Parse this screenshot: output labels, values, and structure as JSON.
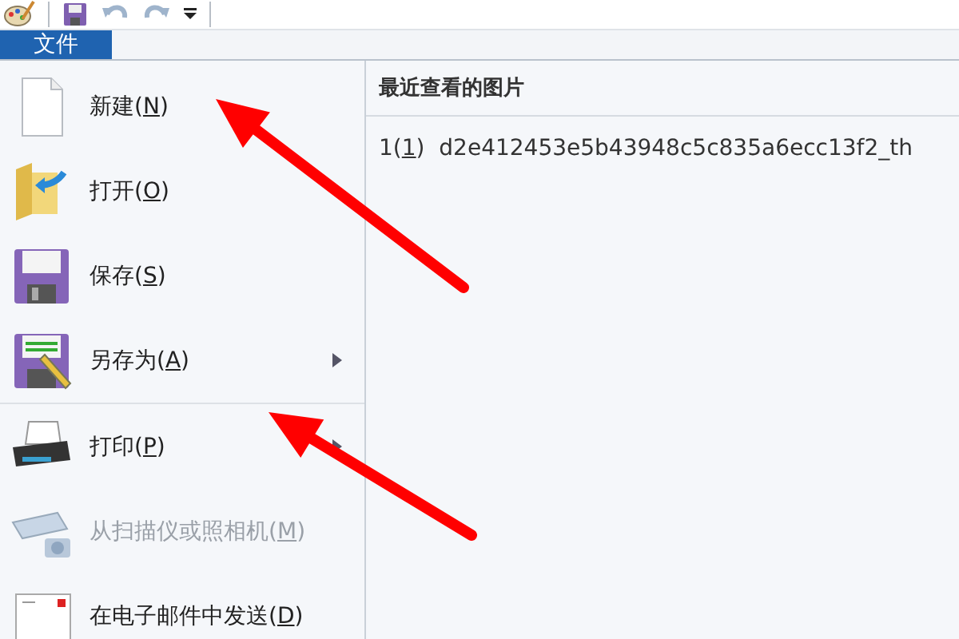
{
  "toolbar": {
    "items": [
      {
        "kind": "paint"
      },
      {
        "kind": "save"
      },
      {
        "kind": "undo",
        "disabled": true
      },
      {
        "kind": "redo",
        "disabled": true
      },
      {
        "kind": "customize"
      }
    ]
  },
  "tabs": [
    {
      "label": "文件",
      "selected": true
    }
  ],
  "menu": {
    "items": [
      {
        "kind": "new",
        "prefix": "新建(",
        "key": "N",
        "suffix": ")",
        "disabled": false,
        "has_submenu": false
      },
      {
        "kind": "open",
        "prefix": "打开(",
        "key": "O",
        "suffix": ")",
        "disabled": false,
        "has_submenu": false
      },
      {
        "kind": "save",
        "prefix": "保存(",
        "key": "S",
        "suffix": ")",
        "disabled": false,
        "has_submenu": false
      },
      {
        "kind": "saveas",
        "prefix": "另存为(",
        "key": "A",
        "suffix": ")",
        "disabled": false,
        "has_submenu": true
      },
      {
        "kind": "print",
        "prefix": "打印(",
        "key": "P",
        "suffix": ")",
        "disabled": false,
        "has_submenu": true,
        "separator_before": true
      },
      {
        "kind": "scan",
        "prefix": "从扫描仪或照相机(",
        "key": "M",
        "suffix": ")",
        "disabled": true,
        "has_submenu": false
      },
      {
        "kind": "email",
        "prefix": "在电子邮件中发送(",
        "key": "D",
        "suffix": ")",
        "disabled": false,
        "has_submenu": false
      }
    ]
  },
  "recent": {
    "title": "最近查看的图片",
    "items": [
      {
        "key": "1",
        "prefix": "1(",
        "suffix": ")",
        "name": "d2e412453e5b43948c5c835a6ecc13f2_th"
      }
    ]
  },
  "annotations": [
    {
      "kind": "arrow"
    },
    {
      "kind": "arrow"
    }
  ]
}
